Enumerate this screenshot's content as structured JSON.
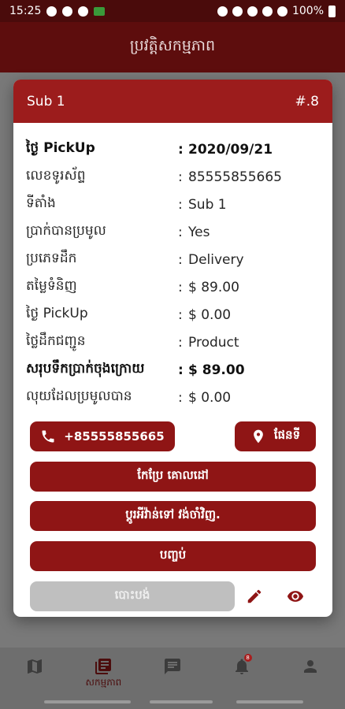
{
  "status_bar": {
    "time": "15:25",
    "battery": "100%"
  },
  "app_bar": {
    "title": "ប្រវត្តិសកម្មភាព"
  },
  "modal": {
    "title": "Sub 1",
    "order_no": "#.8",
    "rows": [
      {
        "label": "ថ្ងៃ PickUp",
        "value": "2020/09/21",
        "bold": true
      },
      {
        "label": "លេខទូរស័ព្ទ",
        "value": "85555855665"
      },
      {
        "label": "ទីតាំង",
        "value": "Sub 1"
      },
      {
        "label": "ប្រាក់បានប្រមូល",
        "value": "Yes"
      },
      {
        "label": "ប្រភេទដឹក",
        "value": "Delivery"
      },
      {
        "label": "តម្លៃទំនិញ",
        "value": "$ 89.00"
      },
      {
        "label": "ថ្ងៃ PickUp",
        "value": "$ 0.00"
      },
      {
        "label": "ថ្លៃដឹកជញ្ជូន",
        "value": "Product"
      },
      {
        "label": "សរុបទឹកប្រាក់ចុងក្រោយ",
        "value": "$ 89.00",
        "bold": true
      },
      {
        "label": "លុយដែលប្រមូលបាន",
        "value": "$ 0.00"
      }
    ],
    "phone_button": "+85555855665",
    "map_button": "ផែនទី",
    "edit_target_button": "កែប្រែ គោលដៅ",
    "return_button": "ប្ដូរអីវ៉ាន់ទៅ វង់ចាំវិញ.",
    "finish_button": "បញ្ចប់",
    "cancel_button": "បោះបង់"
  },
  "bottom_nav": {
    "items": [
      {
        "icon": "map-icon",
        "label": ""
      },
      {
        "icon": "activity-icon",
        "label": "សកម្មភាព"
      },
      {
        "icon": "chat-icon",
        "label": ""
      },
      {
        "icon": "bell-icon",
        "label": "",
        "badge": "8"
      },
      {
        "icon": "person-icon",
        "label": ""
      }
    ]
  },
  "colors": {
    "primary": "#9c1c1c",
    "button": "#8f1515",
    "disabled": "#bfbfbf"
  }
}
